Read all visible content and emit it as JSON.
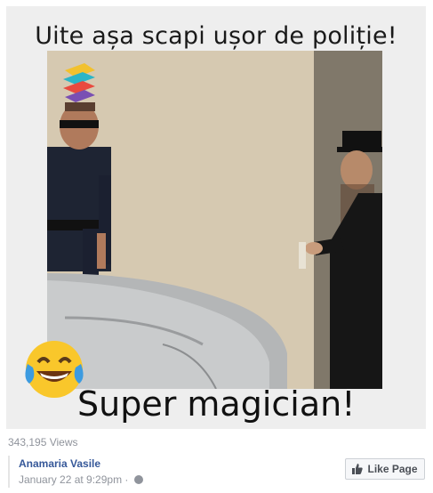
{
  "video": {
    "top_caption": "Uite așa scapi ușor de poliție!",
    "bottom_caption": "Super magician!",
    "emoji": "face-with-tears-of-joy-icon",
    "logo": "brand-logo-icon"
  },
  "post": {
    "views": "343,195 Views",
    "page_name": "Anamaria Vasile",
    "timestamp": "January 22 at 9:29pm",
    "separator": "·",
    "privacy_icon": "globe-icon",
    "like_button": "Like Page",
    "like_icon": "thumbs-up-icon"
  },
  "colors": {
    "link": "#365899",
    "meta": "#90949c",
    "card_bg": "#eeeeee"
  }
}
